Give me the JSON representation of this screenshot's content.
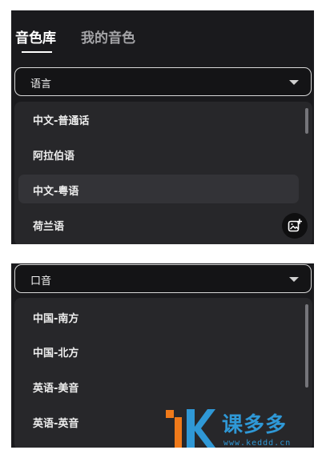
{
  "tabs": [
    {
      "label": "音色库",
      "active": true
    },
    {
      "label": "我的音色",
      "active": false
    }
  ],
  "language_select": {
    "label": "语言",
    "options": [
      "中文-普通话",
      "阿拉伯语",
      "中文-粤语",
      "荷兰语"
    ]
  },
  "accent_select": {
    "label": "口音",
    "options": [
      "中国-南方",
      "中国-北方",
      "英语-美音",
      "英语-英音"
    ]
  },
  "fab_icon": "image-add-icon",
  "watermark": {
    "text": "课多多",
    "url": "www.keddd.cn"
  }
}
